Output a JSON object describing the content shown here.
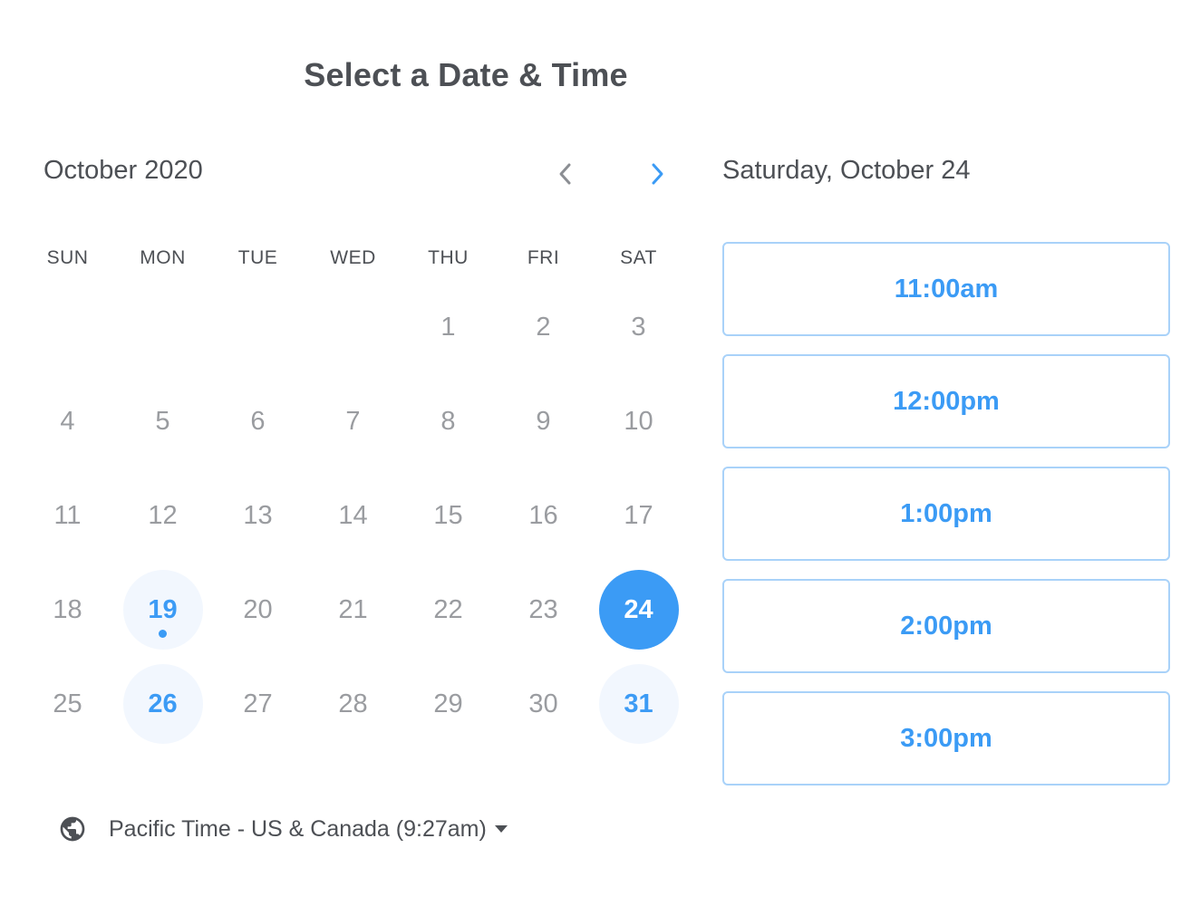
{
  "title": "Select a Date & Time",
  "calendar": {
    "month_label": "October 2020",
    "prev_icon": "chevron-left-icon",
    "next_icon": "chevron-right-icon",
    "weekdays": [
      "SUN",
      "MON",
      "TUE",
      "WED",
      "THU",
      "FRI",
      "SAT"
    ],
    "leading_blanks": 4,
    "days": [
      {
        "label": "1",
        "state": "unavailable"
      },
      {
        "label": "2",
        "state": "unavailable"
      },
      {
        "label": "3",
        "state": "unavailable"
      },
      {
        "label": "4",
        "state": "unavailable"
      },
      {
        "label": "5",
        "state": "unavailable"
      },
      {
        "label": "6",
        "state": "unavailable"
      },
      {
        "label": "7",
        "state": "unavailable"
      },
      {
        "label": "8",
        "state": "unavailable"
      },
      {
        "label": "9",
        "state": "unavailable"
      },
      {
        "label": "10",
        "state": "unavailable"
      },
      {
        "label": "11",
        "state": "unavailable"
      },
      {
        "label": "12",
        "state": "unavailable"
      },
      {
        "label": "13",
        "state": "unavailable"
      },
      {
        "label": "14",
        "state": "unavailable"
      },
      {
        "label": "15",
        "state": "unavailable"
      },
      {
        "label": "16",
        "state": "unavailable"
      },
      {
        "label": "17",
        "state": "unavailable"
      },
      {
        "label": "18",
        "state": "unavailable"
      },
      {
        "label": "19",
        "state": "available",
        "today": true
      },
      {
        "label": "20",
        "state": "unavailable"
      },
      {
        "label": "21",
        "state": "unavailable"
      },
      {
        "label": "22",
        "state": "unavailable"
      },
      {
        "label": "23",
        "state": "unavailable"
      },
      {
        "label": "24",
        "state": "selected"
      },
      {
        "label": "25",
        "state": "unavailable"
      },
      {
        "label": "26",
        "state": "available"
      },
      {
        "label": "27",
        "state": "unavailable"
      },
      {
        "label": "28",
        "state": "unavailable"
      },
      {
        "label": "29",
        "state": "unavailable"
      },
      {
        "label": "30",
        "state": "unavailable"
      },
      {
        "label": "31",
        "state": "available"
      }
    ]
  },
  "timezone": {
    "icon": "globe-icon",
    "label": "Pacific Time - US & Canada (9:27am)",
    "caret_icon": "caret-down-icon"
  },
  "selected_date_heading": "Saturday, October 24",
  "time_slots": [
    "11:00am",
    "12:00pm",
    "1:00pm",
    "2:00pm",
    "3:00pm"
  ],
  "colors": {
    "accent": "#3b9bf5",
    "available_bg": "#f2f7fe",
    "slot_border": "#a9d2f9",
    "text": "#4d5055",
    "muted_text": "#9a9ca0"
  }
}
